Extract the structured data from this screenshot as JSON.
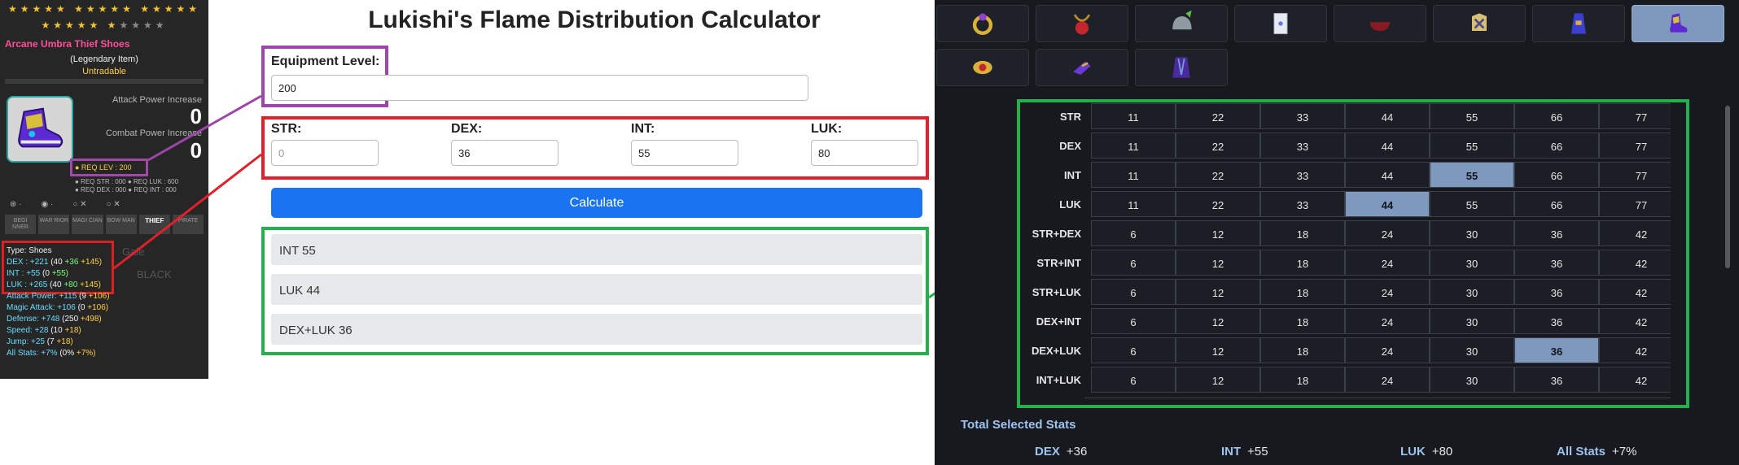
{
  "tooltip": {
    "stars_on_row1": 15,
    "stars_row2_on": 6,
    "stars_row2_off": 4,
    "item_name": "Arcane Umbra Thief Shoes",
    "tier": "(Legendary Item)",
    "trade": "Untradable",
    "attack_power_label": "Attack Power Increase",
    "attack_power_value": "0",
    "combat_power_label": "Combat Power Increase",
    "combat_power_value": "0",
    "req_lev": "● REQ LEV : 200",
    "req_lines": [
      "● REQ STR : 000   ● REQ LUK : 600",
      "● REQ DEX : 000   ● REQ INT : 000"
    ],
    "jobs": [
      "BEGI NNER",
      "WAR RIOR",
      "MAGI CIAN",
      "BOW MAN",
      "THIEF",
      "PIRATE"
    ],
    "active_job": "THIEF",
    "stats": {
      "type": "Type: Shoes",
      "dex": {
        "k": "DEX : +221 ",
        "base": "(40 ",
        "a": "+36 ",
        "b": "+145)"
      },
      "int": {
        "k": "INT : +55 ",
        "base": "(0 ",
        "a": "+55)"
      },
      "luk": {
        "k": "LUK : +265 ",
        "base": "(40 ",
        "a": "+80 ",
        "b": "+145)"
      },
      "atk": {
        "k": "Attack Power: +115 ",
        "base": "(9 ",
        "a": "+106)"
      },
      "matk": {
        "k": "Magic Attack: +106 ",
        "base": "(0 ",
        "a": "+106)"
      },
      "def": {
        "k": "Defense: +748 ",
        "base": "(250 ",
        "a": "+498)"
      },
      "speed": {
        "k": "Speed: +28 ",
        "base": "(10 ",
        "a": "+18)"
      },
      "jump": {
        "k": "Jump: +25 ",
        "base": "(7 ",
        "a": "+18)"
      },
      "allstats": {
        "k": "All Stats: +7% ",
        "base": "(0% ",
        "a": "+7%)"
      }
    }
  },
  "calculator": {
    "title": "Lukishi's Flame Distribution Calculator",
    "level_label": "Equipment Level:",
    "level_value": "200",
    "fields": [
      {
        "label": "STR:",
        "value": "",
        "placeholder": "0"
      },
      {
        "label": "DEX:",
        "value": "36",
        "placeholder": ""
      },
      {
        "label": "INT:",
        "value": "55",
        "placeholder": ""
      },
      {
        "label": "LUK:",
        "value": "80",
        "placeholder": ""
      }
    ],
    "button": "Calculate",
    "results": [
      "INT 55",
      "LUK 44",
      "DEX+LUK 36"
    ]
  },
  "flame_panel": {
    "equip_icons": [
      "ring-icon",
      "pendant-icon",
      "helmet-icon",
      "card-icon",
      "bowl-hat-icon",
      "armor-icon",
      "robe-icon",
      "shoes-icon",
      "belt-icon",
      "glove-icon",
      "cape-icon"
    ],
    "selected_icon": "shoes-icon",
    "rows": [
      {
        "label": "STR",
        "values": [
          "11",
          "22",
          "33",
          "44",
          "55",
          "66",
          "77"
        ],
        "selected": -1
      },
      {
        "label": "DEX",
        "values": [
          "11",
          "22",
          "33",
          "44",
          "55",
          "66",
          "77"
        ],
        "selected": -1
      },
      {
        "label": "INT",
        "values": [
          "11",
          "22",
          "33",
          "44",
          "55",
          "66",
          "77"
        ],
        "selected": 4
      },
      {
        "label": "LUK",
        "values": [
          "11",
          "22",
          "33",
          "44",
          "55",
          "66",
          "77"
        ],
        "selected": 3
      },
      {
        "label": "STR+DEX",
        "values": [
          "6",
          "12",
          "18",
          "24",
          "30",
          "36",
          "42"
        ],
        "selected": -1
      },
      {
        "label": "STR+INT",
        "values": [
          "6",
          "12",
          "18",
          "24",
          "30",
          "36",
          "42"
        ],
        "selected": -1
      },
      {
        "label": "STR+LUK",
        "values": [
          "6",
          "12",
          "18",
          "24",
          "30",
          "36",
          "42"
        ],
        "selected": -1
      },
      {
        "label": "DEX+INT",
        "values": [
          "6",
          "12",
          "18",
          "24",
          "30",
          "36",
          "42"
        ],
        "selected": -1
      },
      {
        "label": "DEX+LUK",
        "values": [
          "6",
          "12",
          "18",
          "24",
          "30",
          "36",
          "42"
        ],
        "selected": 5
      },
      {
        "label": "INT+LUK",
        "values": [
          "6",
          "12",
          "18",
          "24",
          "30",
          "36",
          "42"
        ],
        "selected": -1
      }
    ],
    "total_title": "Total Selected Stats",
    "totals": [
      {
        "k": "DEX",
        "v": "+36"
      },
      {
        "k": "INT",
        "v": "+55"
      },
      {
        "k": "LUK",
        "v": "+80"
      },
      {
        "k": "All Stats",
        "v": "+7%"
      }
    ],
    "colors": {
      "selected": "#7e99bd",
      "panel": "#17191e",
      "accent_text": "#9ec3ef"
    }
  },
  "annotation_colors": {
    "purple": "#9b46a8",
    "red": "#e0202a",
    "green": "#22b14c"
  }
}
